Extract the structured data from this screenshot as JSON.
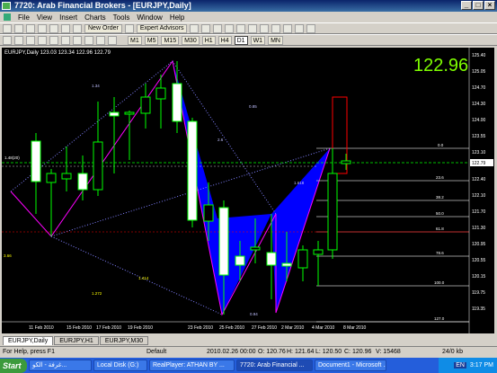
{
  "window": {
    "title": "7720: Arab Financial Brokers - [EURJPY,Daily]",
    "buttons": [
      "_",
      "□",
      "×"
    ]
  },
  "menu": [
    "File",
    "View",
    "Insert",
    "Charts",
    "Tools",
    "Window",
    "Help"
  ],
  "toolbar": {
    "new_order": "New Order",
    "expert_advisors": "Expert Advisors"
  },
  "timeframes": [
    "M1",
    "M5",
    "M15",
    "M30",
    "H1",
    "H4",
    "D1",
    "W1",
    "MN"
  ],
  "active_timeframe": "D1",
  "chart": {
    "symbol_line": "EURJPY,Daily  123.03 123.34 122.96 122.79",
    "big_price": "122.96",
    "price_labels": [
      "125.40",
      "125.05",
      "124.70",
      "124.30",
      "124.00",
      "123.55",
      "123.10",
      "122.79",
      "122.40",
      "122.10",
      "121.70",
      "121.30",
      "120.95",
      "120.55",
      "120.15",
      "119.75",
      "119.35"
    ],
    "date_labels": [
      "11 Feb 2010",
      "15 Feb 2010",
      "17 Feb 2010",
      "19 Feb 2010",
      "23 Feb 2010",
      "25 Feb 2010",
      "27 Feb 2010",
      "2 Mar 2010",
      "4 Mar 2010",
      "8 Mar 2010"
    ],
    "fib_labels": [
      "0.0",
      "23.6",
      "38.2",
      "50.0",
      "61.8",
      "78.6",
      "100.0",
      "127.0"
    ],
    "pattern_labels": [
      "1.34",
      "0.85",
      "1.272",
      "1.414",
      "0.94",
      "1.618",
      "2.6",
      "3.66",
      "1.48(20)"
    ],
    "colors": {
      "pattern_fill": "#0000ff",
      "bull_candle": "#ffffff",
      "bear_candle": "#000000",
      "wick": "#00ff00",
      "price": "#7fff00",
      "zigzag": "#ff00ff"
    }
  },
  "tabs": [
    "EURJPY,Daily",
    "EURJPY,H1",
    "EURJPY,M30"
  ],
  "status": {
    "help": "For Help, press F1",
    "profile": "Default",
    "datetime": "2010.02.26 00:00",
    "open": "O: 120.76",
    "high": "H: 121.64",
    "low": "L: 120.50",
    "close": "C: 120.96",
    "volume": "V: 15468",
    "traffic": "24/0 kb"
  },
  "taskbar": {
    "start": "Start",
    "tasks": [
      "غرفة - الكو...",
      "Local Disk (G:)",
      "RealPlayer: ATHAN BY ...",
      "7720: Arab Financial ...",
      "Document1 - Microsoft ..."
    ],
    "lang": "EN",
    "clock": "3:17 PM"
  }
}
